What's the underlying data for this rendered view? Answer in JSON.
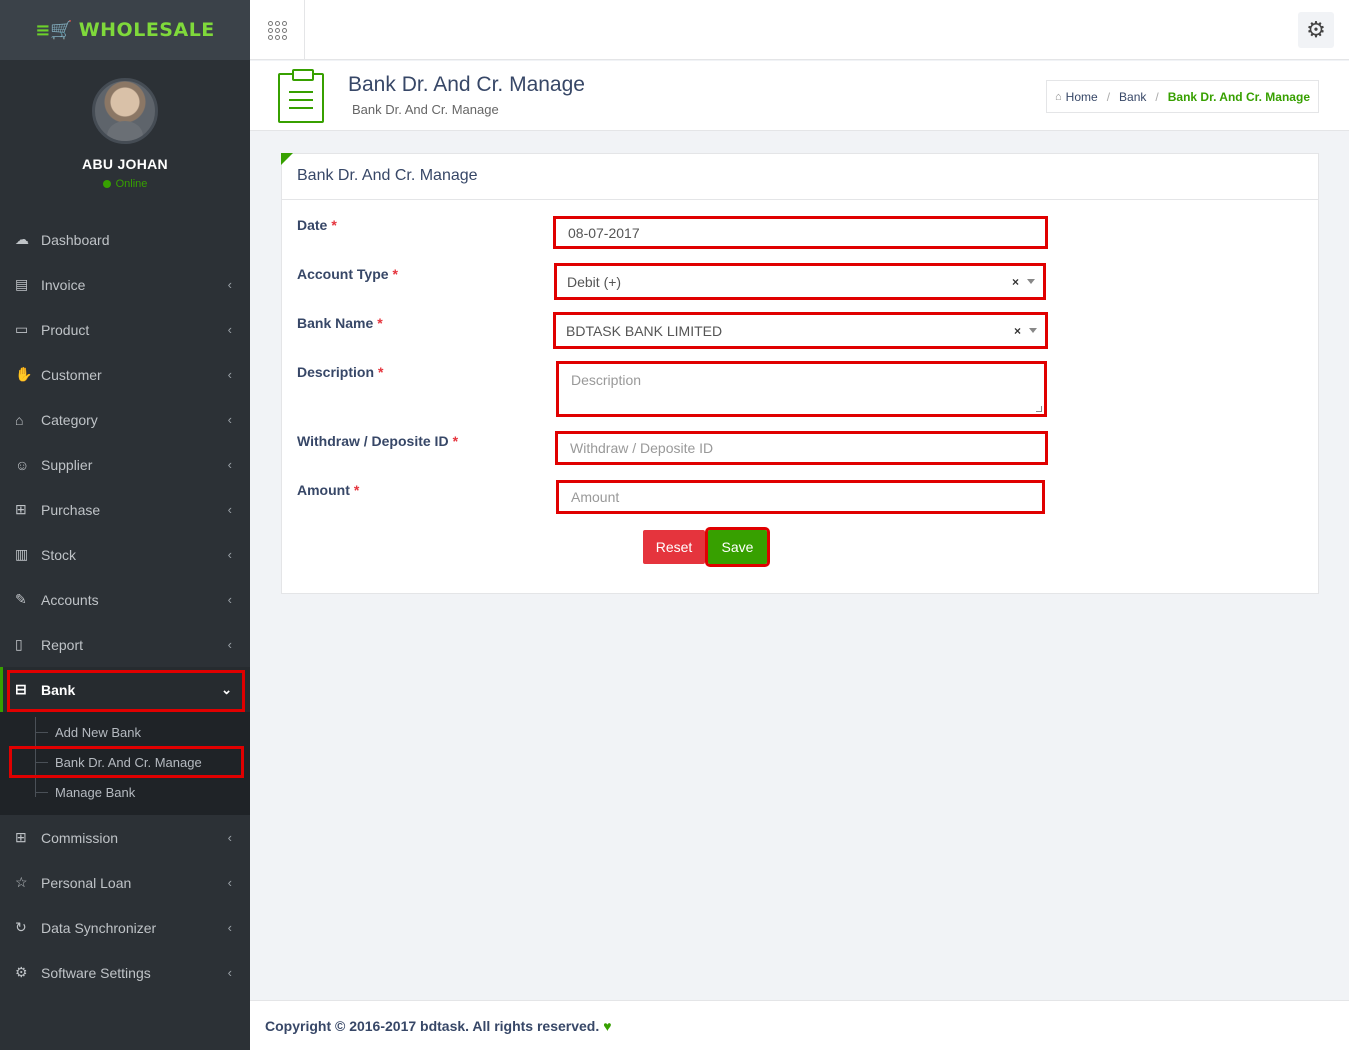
{
  "brand": {
    "name": "WHOLESALE"
  },
  "user": {
    "name": "ABU JOHAN",
    "status": "Online"
  },
  "nav": [
    {
      "label": "Dashboard",
      "icon": "dashboard-icon",
      "glyph": "☁",
      "has_children": false
    },
    {
      "label": "Invoice",
      "icon": "invoice-icon",
      "glyph": "▤",
      "has_children": true
    },
    {
      "label": "Product",
      "icon": "product-icon",
      "glyph": "▭",
      "has_children": true
    },
    {
      "label": "Customer",
      "icon": "customer-icon",
      "glyph": "✋",
      "has_children": true
    },
    {
      "label": "Category",
      "icon": "category-icon",
      "glyph": "⌂",
      "has_children": true
    },
    {
      "label": "Supplier",
      "icon": "supplier-icon",
      "glyph": "☺",
      "has_children": true
    },
    {
      "label": "Purchase",
      "icon": "cart-icon",
      "glyph": "⊞",
      "has_children": true
    },
    {
      "label": "Stock",
      "icon": "stock-icon",
      "glyph": "▥",
      "has_children": true
    },
    {
      "label": "Accounts",
      "icon": "accounts-icon",
      "glyph": "✎",
      "has_children": true
    },
    {
      "label": "Report",
      "icon": "report-icon",
      "glyph": "▯",
      "has_children": true
    }
  ],
  "bank_nav": {
    "label": "Bank",
    "icon": "bank-icon",
    "glyph": "⊟"
  },
  "bank_submenu": [
    "Add New Bank",
    "Bank Dr. And Cr. Manage",
    "Manage Bank"
  ],
  "nav_after": [
    {
      "label": "Commission",
      "icon": "commission-icon",
      "glyph": "⊞"
    },
    {
      "label": "Personal Loan",
      "icon": "star-icon",
      "glyph": "☆"
    },
    {
      "label": "Data Synchronizer",
      "icon": "sync-icon",
      "glyph": "↻"
    },
    {
      "label": "Software Settings",
      "icon": "settings-icon",
      "glyph": "⚙"
    }
  ],
  "header": {
    "title": "Bank Dr. And Cr. Manage",
    "subtitle": "Bank Dr. And Cr. Manage",
    "breadcrumb": {
      "home": "Home",
      "section": "Bank",
      "current": "Bank Dr. And Cr. Manage"
    }
  },
  "panel": {
    "title": "Bank Dr. And Cr. Manage",
    "fields": {
      "date": {
        "label": "Date",
        "value": "08-07-2017"
      },
      "account_type": {
        "label": "Account Type",
        "value": "Debit (+)"
      },
      "bank_name": {
        "label": "Bank Name",
        "value": "BDTASK BANK LIMITED"
      },
      "description": {
        "label": "Description",
        "placeholder": "Description"
      },
      "withdraw_id": {
        "label": "Withdraw / Deposite ID",
        "placeholder": "Withdraw / Deposite ID"
      },
      "amount": {
        "label": "Amount",
        "placeholder": "Amount"
      }
    },
    "reset_label": "Reset",
    "save_label": "Save"
  },
  "footer": {
    "text": "Copyright © 2016-2017 bdtask. All rights reserved."
  },
  "colors": {
    "accent": "#37a000",
    "danger": "#e5343d",
    "sidebar": "#2c3136",
    "highlight": "#e00000"
  }
}
